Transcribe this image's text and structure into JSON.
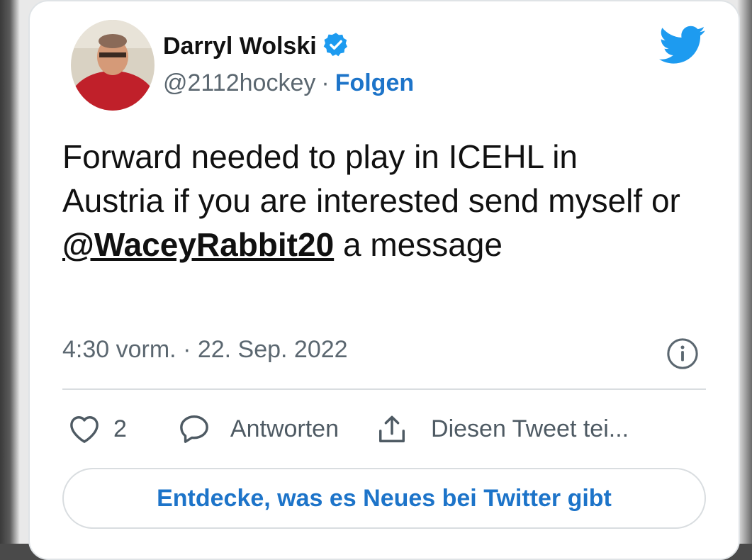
{
  "tweet": {
    "author_name": "Darryl Wolski",
    "handle": "@2112hockey",
    "separator": "·",
    "follow_label": "Folgen",
    "text_before_mention": "Forward needed to play in ICEHL in Austria if you are interested send myself or ",
    "mention": "@WaceyRabbit20",
    "text_after_mention": " a message",
    "timestamp": "4:30 vorm. · 22. Sep. 2022",
    "verified": true
  },
  "actions": {
    "like_count": "2",
    "reply_label": "Antworten",
    "share_label": "Diesen Tweet tei..."
  },
  "discover_button_label": "Entdecke, was es Neues bei Twitter gibt",
  "icons": {
    "verified": "verified-badge-icon",
    "bird": "twitter-bird-icon",
    "info": "info-icon",
    "like": "heart-icon",
    "reply": "speech-bubble-icon",
    "share": "share-upload-icon"
  },
  "colors": {
    "accent": "#1d9bf0",
    "link": "#1d74c9",
    "muted": "#5b6770",
    "text": "#111111"
  }
}
